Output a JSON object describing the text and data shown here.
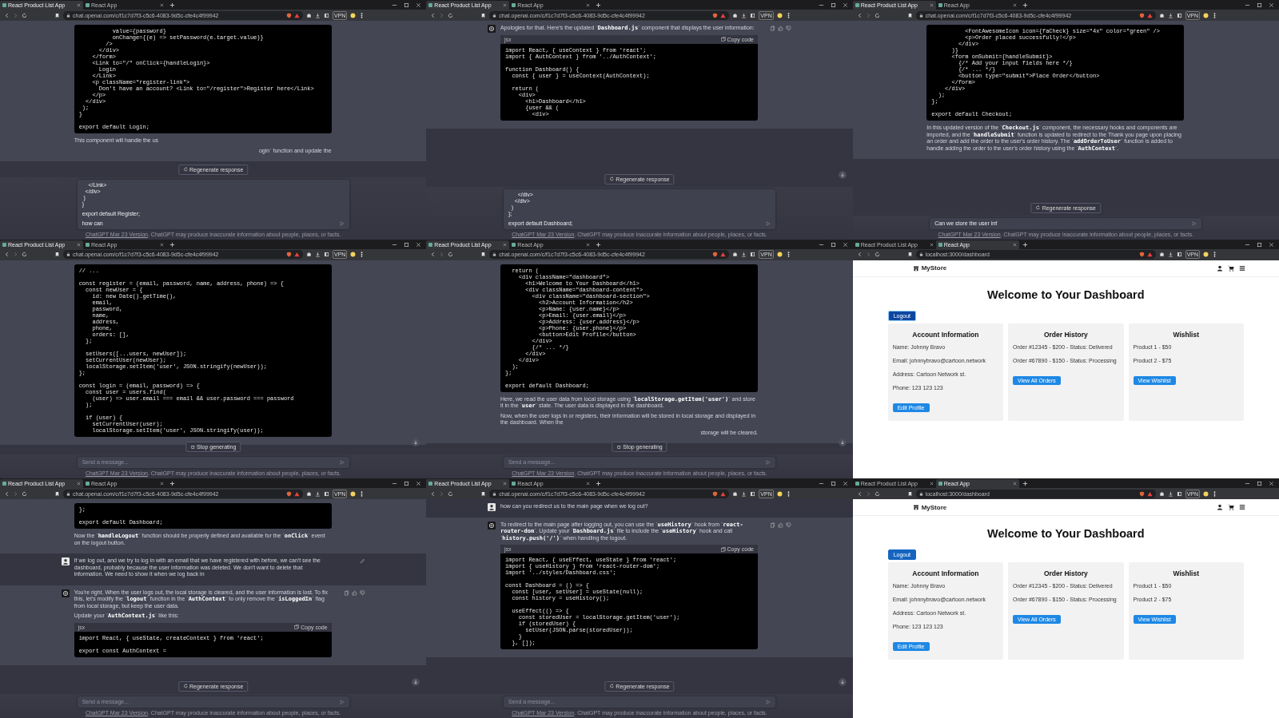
{
  "panels": [
    {
      "kind": "chat",
      "browser": {
        "tabs": [
          {
            "title": "React Product List App",
            "selected": true
          },
          {
            "title": "React App",
            "selected": false
          }
        ],
        "url": "chat.openai.com/c/f1c7d7f3-c5c6-4083-9d5c-cfe4c4f99942",
        "vpn": "VPN"
      },
      "messages": [
        {
          "kind": "assistant",
          "start_visible": false,
          "actions": false,
          "content": [
            {
              "kind": "code",
              "lines": [
                {
                  "text": "          value={password}"
                },
                {
                  "text": "          onChange={(e) => setPassword(e.target.value)}"
                },
                {
                  "text": "        />"
                },
                {
                  "text": "      </div>"
                },
                {
                  "text": "    </form>"
                },
                {
                  "text": "    <Link to=\"/\" onClick={handleLogin}>"
                },
                {
                  "text": "      Login"
                },
                {
                  "text": "    </Link>"
                },
                {
                  "text": "    <p className=\"register-link\">"
                },
                {
                  "text": "      Don't have an account? <Link to=\"/register\">Register here</Link>"
                },
                {
                  "text": "    </p>"
                },
                {
                  "text": "  </div>"
                },
                {
                  "text": " );"
                },
                {
                  "text": "}"
                },
                {
                  "text": "export default Login;",
                  "gap_before": true
                }
              ]
            },
            {
              "kind": "split_text",
              "left": "This component will handle the us",
              "right": "ogin` function and update the"
            }
          ]
        }
      ],
      "floating": {
        "kind": "regenerate",
        "label": "Regenerate response"
      },
      "scroll_button": false,
      "composer": {
        "lines": [
          {
            "text": "    </Link>"
          },
          {
            "text": "  </div>"
          },
          {
            "text": " )"
          },
          {
            "text": "}"
          },
          {
            "text": "export default Register;",
            "gap_before": true
          },
          {
            "text": "how can",
            "gap_before": true
          }
        ]
      },
      "footer": {
        "link": "ChatGPT Mar 23 Version",
        "text": ". ChatGPT may produce inaccurate information about people, places, or facts."
      }
    },
    {
      "kind": "chat",
      "browser": {
        "tabs": [
          {
            "title": "React Product List App",
            "selected": true
          },
          {
            "title": "React App",
            "selected": false
          }
        ],
        "url": "chat.openai.com/c/f1c7d7f3-c5c6-4083-9d5c-cfe4c4f99942",
        "vpn": "VPN"
      },
      "messages": [
        {
          "kind": "assistant",
          "start_visible": true,
          "actions": true,
          "content": [
            {
              "kind": "text",
              "text": "Apologies for that. Here's the updated `**Dashboard.js**` component that displays the user information:"
            },
            {
              "kind": "code",
              "lang": "jsx",
              "copy": "Copy code",
              "lines": [
                {
                  "text": "import React, { useContext } from 'react';"
                },
                {
                  "text": "import { AuthContext } from '../AuthContext';"
                },
                {
                  "text": "function Dashboard() {",
                  "gap_before": true
                },
                {
                  "text": "  const { user } = useContext(AuthContext);"
                },
                {
                  "text": "  return (",
                  "gap_before": true
                },
                {
                  "text": "    <div>"
                },
                {
                  "text": "      <h1>Dashboard</h1>"
                },
                {
                  "text": "      {user && ("
                },
                {
                  "text": "        <div>"
                }
              ]
            }
          ]
        }
      ],
      "floating": {
        "kind": "regenerate",
        "label": "Regenerate response"
      },
      "scroll_button": true,
      "composer": {
        "lines": [
          {
            "text": "      </div>"
          },
          {
            "text": "    </div>"
          },
          {
            "text": "  )"
          },
          {
            "text": "};"
          },
          {
            "text": "export default Dashboard;",
            "gap_before": true
          }
        ]
      },
      "footer": {
        "link": "ChatGPT Mar 23 Version",
        "text": ". ChatGPT may produce inaccurate information about people, places, or facts."
      }
    },
    {
      "kind": "chat",
      "browser": {
        "tabs": [
          {
            "title": "React Product List App",
            "selected": true
          },
          {
            "title": "React App",
            "selected": false
          }
        ],
        "url": "chat.openai.com/c/f1c7d7f3-c5c6-4083-9d5c-cfe4c4f99942",
        "vpn": "VPN"
      },
      "messages": [
        {
          "kind": "assistant",
          "start_visible": false,
          "actions": false,
          "content": [
            {
              "kind": "code",
              "lines": [
                {
                  "text": "          <FontAwesomeIcon icon={faCheck} size=\"4x\" color=\"green\" />"
                },
                {
                  "text": "          <p>Order placed successfully!</p>"
                },
                {
                  "text": "        </div>"
                },
                {
                  "text": "      )}"
                },
                {
                  "text": "      <form onSubmit={handleSubmit}>"
                },
                {
                  "text": "        {/* Add your input fields here */}"
                },
                {
                  "text": "        {/* ... */}"
                },
                {
                  "text": "        <button type=\"submit\">Place Order</button>"
                },
                {
                  "text": "      </form>"
                },
                {
                  "text": "    </div>"
                },
                {
                  "text": "  );"
                },
                {
                  "text": "};"
                },
                {
                  "text": "export default Checkout;",
                  "gap_before": true
                }
              ]
            },
            {
              "kind": "text",
              "text": "In this updated version of the `**Checkout.js**` component, the necessary hooks and components are imported, and the `**handleSubmit**` function is updated to redirect to the Thank you page upon placing an order and add the order to the user's order history. The `**addOrderToUser**` function is added to handle adding the order to the user's order history using the `**AuthContext**`."
            }
          ]
        }
      ],
      "floating": {
        "kind": "regenerate",
        "label": "Regenerate response"
      },
      "scroll_button": false,
      "composer": {
        "value": "Can we store the user inf"
      },
      "footer": {
        "link": "ChatGPT Mar 23 Version",
        "text": ". ChatGPT may produce inaccurate information about people, places, or facts."
      }
    },
    {
      "kind": "chat",
      "browser": {
        "tabs": [
          {
            "title": "React Product List App",
            "selected": true
          },
          {
            "title": "React App",
            "selected": false
          }
        ],
        "url": "chat.openai.com/c/f1c7d7f3-c5c6-4083-9d5c-cfe4c4f99942",
        "vpn": "VPN"
      },
      "messages": [
        {
          "kind": "assistant",
          "start_visible": false,
          "actions": false,
          "content": [
            {
              "kind": "code",
              "lines": [
                {
                  "text": "// ..."
                },
                {
                  "text": "const register = (email, password, name, address, phone) => {",
                  "gap_before": true
                },
                {
                  "text": "  const newUser = {"
                },
                {
                  "text": "    id: new Date().getTime(),"
                },
                {
                  "text": "    email,"
                },
                {
                  "text": "    password,"
                },
                {
                  "text": "    name,"
                },
                {
                  "text": "    address,"
                },
                {
                  "text": "    phone,"
                },
                {
                  "text": "    orders: [],"
                },
                {
                  "text": "  };"
                },
                {
                  "text": "  setUsers([...users, newUser]);",
                  "gap_before": true
                },
                {
                  "text": "  setCurrentUser(newUser);"
                },
                {
                  "text": "  localStorage.setItem('user', JSON.stringify(newUser));"
                },
                {
                  "text": "};"
                },
                {
                  "text": "const login = (email, password) => {",
                  "gap_before": true
                },
                {
                  "text": "  const user = users.find("
                },
                {
                  "text": "    (user) => user.email === email && user.password === password"
                },
                {
                  "text": "  );"
                },
                {
                  "text": "  if (user) {",
                  "gap_before": true
                },
                {
                  "text": "    setCurrentUser(user);"
                },
                {
                  "text": "    localStorage.setItem('user', JSON.stringify(user));"
                }
              ]
            }
          ]
        }
      ],
      "floating": {
        "kind": "stop",
        "label": "Stop generating"
      },
      "scroll_button": true,
      "composer": {
        "placeholder": "Send a message..."
      },
      "footer": {
        "link": "ChatGPT Mar 23 Version",
        "text": ". ChatGPT may produce inaccurate information about people, places, or facts."
      }
    },
    {
      "kind": "chat",
      "browser": {
        "tabs": [
          {
            "title": "React Product List App",
            "selected": true
          },
          {
            "title": "React App",
            "selected": false
          }
        ],
        "url": "chat.openai.com/c/f1c7d7f3-c5c6-4083-9d5c-cfe4c4f99942",
        "vpn": "VPN"
      },
      "messages": [
        {
          "kind": "assistant",
          "start_visible": false,
          "actions": false,
          "content": [
            {
              "kind": "code",
              "lines": [
                {
                  "text": "  return ("
                },
                {
                  "text": "    <div className=\"dashboard\">"
                },
                {
                  "text": "      <h1>Welcome to Your Dashboard</h1>"
                },
                {
                  "text": "      <div className=\"dashboard-content\">"
                },
                {
                  "text": "        <div className=\"dashboard-section\">"
                },
                {
                  "text": "          <h2>Account Information</h2>"
                },
                {
                  "text": "          <p>Name: {user.name}</p>"
                },
                {
                  "text": "          <p>Email: {user.email}</p>"
                },
                {
                  "text": "          <p>Address: {user.address}</p>"
                },
                {
                  "text": "          <p>Phone: {user.phone}</p>"
                },
                {
                  "text": "          <button>Edit Profile</button>"
                },
                {
                  "text": "        </div>"
                },
                {
                  "text": "        {/* ... */}"
                },
                {
                  "text": "      </div>"
                },
                {
                  "text": "    </div>"
                },
                {
                  "text": "  );"
                },
                {
                  "text": "};"
                },
                {
                  "text": "export default Dashboard;",
                  "gap_before": true
                }
              ]
            },
            {
              "kind": "text",
              "text": "Here, we read the user data from local storage using `**localStorage.getItem('user')**` and store it in the `**user**` state. The user data is displayed in the dashboard."
            },
            {
              "kind": "split_text",
              "left": "Now, when the user logs in or registers, their information will be stored in local storage and displayed in the dashboard. When the",
              "right": "storage will be cleared."
            }
          ]
        }
      ],
      "floating": {
        "kind": "stop",
        "label": "Stop generating"
      },
      "scroll_button": true,
      "composer": {
        "placeholder": "Send a message..."
      },
      "footer": {
        "link": "ChatGPT Mar 23 Version",
        "text": ". ChatGPT may produce inaccurate information about people, places, or facts."
      }
    },
    {
      "kind": "store",
      "browser": {
        "tabs": [
          {
            "title": "React Product List App",
            "selected": false
          },
          {
            "title": "React App",
            "selected": true
          }
        ],
        "url": "localhost:3000/dashboard",
        "vpn": "VPN"
      },
      "store": {
        "brand": "MyStore",
        "title": "Welcome to Your Dashboard",
        "logout": {
          "label": "Logout",
          "hovered": true
        },
        "cards": [
          {
            "title": "Account Information",
            "items": [
              "Name: Johnny Bravo",
              "Email: johnnybravo@cartoon.network",
              "Address: Cartoon Network st.",
              "Phone: 123 123 123"
            ],
            "button": "Edit Profile"
          },
          {
            "title": "Order History",
            "items": [
              "Order #12345 - $200 - Status: Delivered",
              "Order #67890 - $150 - Status: Processing"
            ],
            "button": "View All Orders"
          },
          {
            "title": "Wishlist",
            "items": [
              "Product 1 - $50",
              "Product 2 - $75"
            ],
            "button": "View Wishlist"
          }
        ]
      }
    },
    {
      "kind": "chat",
      "browser": {
        "tabs": [
          {
            "title": "React Product List App",
            "selected": true
          },
          {
            "title": "React App",
            "selected": false
          }
        ],
        "url": "chat.openai.com/c/f1c7d7f3-c5c6-4083-9d5c-cfe4c4f99942",
        "vpn": "VPN"
      },
      "messages": [
        {
          "kind": "assistant",
          "start_visible": false,
          "actions": false,
          "content": [
            {
              "kind": "code",
              "lines": [
                {
                  "text": "};"
                },
                {
                  "text": "export default Dashboard;",
                  "gap_before": true
                }
              ]
            },
            {
              "kind": "text",
              "text": "Now the `**handleLogout**` function should be properly defined and available for the `**onClick**` event on the logout button."
            }
          ]
        },
        {
          "kind": "user",
          "start_visible": true,
          "actions": true,
          "content": [
            {
              "kind": "text",
              "text": "If we log out, and we try to log in with an email that we have registered with before, we can't see the dashboard, probably because the user information was deleted. We don't want to delete that information. We need to show it when we log back in"
            }
          ]
        },
        {
          "kind": "assistant",
          "start_visible": true,
          "actions": true,
          "content": [
            {
              "kind": "text",
              "text": "You're right. When the user logs out, the local storage is cleared, and the user information is lost. To fix this, let's modify the `**logout**` function in the `**AuthContext**` to only remove the `**isLoggedIn**` flag from local storage, but keep the user data."
            },
            {
              "kind": "text",
              "text": "Update your `**AuthContext.js**` like this:"
            },
            {
              "kind": "code",
              "lang": "jsx",
              "copy": "Copy code",
              "lines": [
                {
                  "text": "import React, { useState, createContext } from 'react';"
                },
                {
                  "text": "export const AuthContext =",
                  "gap_before": true
                }
              ]
            }
          ]
        }
      ],
      "floating": {
        "kind": "regenerate",
        "label": "Regenerate response"
      },
      "scroll_button": true,
      "composer": {
        "placeholder": "Send a message..."
      },
      "footer": {
        "link": "ChatGPT Mar 23 Version",
        "text": ". ChatGPT may produce inaccurate information about people, places, or facts."
      }
    },
    {
      "kind": "chat",
      "browser": {
        "tabs": [
          {
            "title": "React Product List App",
            "selected": true
          },
          {
            "title": "React App",
            "selected": false
          }
        ],
        "url": "chat.openai.com/c/f1c7d7f3-c5c6-4083-9d5c-cfe4c4f99942",
        "vpn": "VPN"
      },
      "messages": [
        {
          "kind": "user",
          "start_visible": true,
          "actions": false,
          "content": [
            {
              "kind": "text",
              "text": "how can you redirect us to the main page when we log out?"
            }
          ]
        },
        {
          "kind": "assistant",
          "start_visible": true,
          "actions": true,
          "content": [
            {
              "kind": "text",
              "text": "To redirect to the main page after logging out, you can use the `**useHistory**` hook from `**react-router-dom**`. Update your `**Dashboard.js**` file to include the `**useHistory**` hook and call `**history.push('/')**` when handling the logout."
            },
            {
              "kind": "code",
              "lang": "jsx",
              "copy": "Copy code",
              "lines": [
                {
                  "text": "import React, { useEffect, useState } from 'react';"
                },
                {
                  "text": "import { useHistory } from 'react-router-dom';"
                },
                {
                  "text": "import '../styles/Dashboard.css';"
                },
                {
                  "text": "const Dashboard = () => {",
                  "gap_before": true
                },
                {
                  "text": "  const [user, setUser] = useState(null);"
                },
                {
                  "text": "  const history = useHistory();"
                },
                {
                  "text": "  useEffect(() => {",
                  "gap_before": true
                },
                {
                  "text": "    const storedUser = localStorage.getItem('user');"
                },
                {
                  "text": "    if (storedUser) {"
                },
                {
                  "text": "      setUser(JSON.parse(storedUser));"
                },
                {
                  "text": "    }"
                },
                {
                  "text": "  }, []);"
                }
              ]
            }
          ]
        }
      ],
      "floating": {
        "kind": "regenerate",
        "label": "Regenerate response"
      },
      "scroll_button": true,
      "composer": {
        "placeholder": "Send a message..."
      },
      "footer": {
        "link": "ChatGPT Mar 23 Version",
        "text": ". ChatGPT may produce inaccurate information about people, places, or facts."
      }
    },
    {
      "kind": "store",
      "browser": {
        "tabs": [
          {
            "title": "React Product List App",
            "selected": false
          },
          {
            "title": "React App",
            "selected": true
          }
        ],
        "url": "localhost:3000/dashboard",
        "vpn": "VPN"
      },
      "store": {
        "brand": "MyStore",
        "title": "Welcome to Your Dashboard",
        "logout": {
          "label": "Logout",
          "hovered": false
        },
        "cards": [
          {
            "title": "Account Information",
            "items": [
              "Name: Johnny Bravo",
              "Email: johnnybravo@cartoon.network",
              "Address: Cartoon Network st.",
              "Phone: 123 123 123"
            ],
            "button": "Edit Profile"
          },
          {
            "title": "Order History",
            "items": [
              "Order #12345 - $200 - Status: Delivered",
              "Order #67890 - $150 - Status: Processing"
            ],
            "button": "View All Orders"
          },
          {
            "title": "Wishlist",
            "items": [
              "Product 1 - $50",
              "Product 2 - $75"
            ],
            "button": "View Wishlist"
          }
        ]
      }
    }
  ]
}
